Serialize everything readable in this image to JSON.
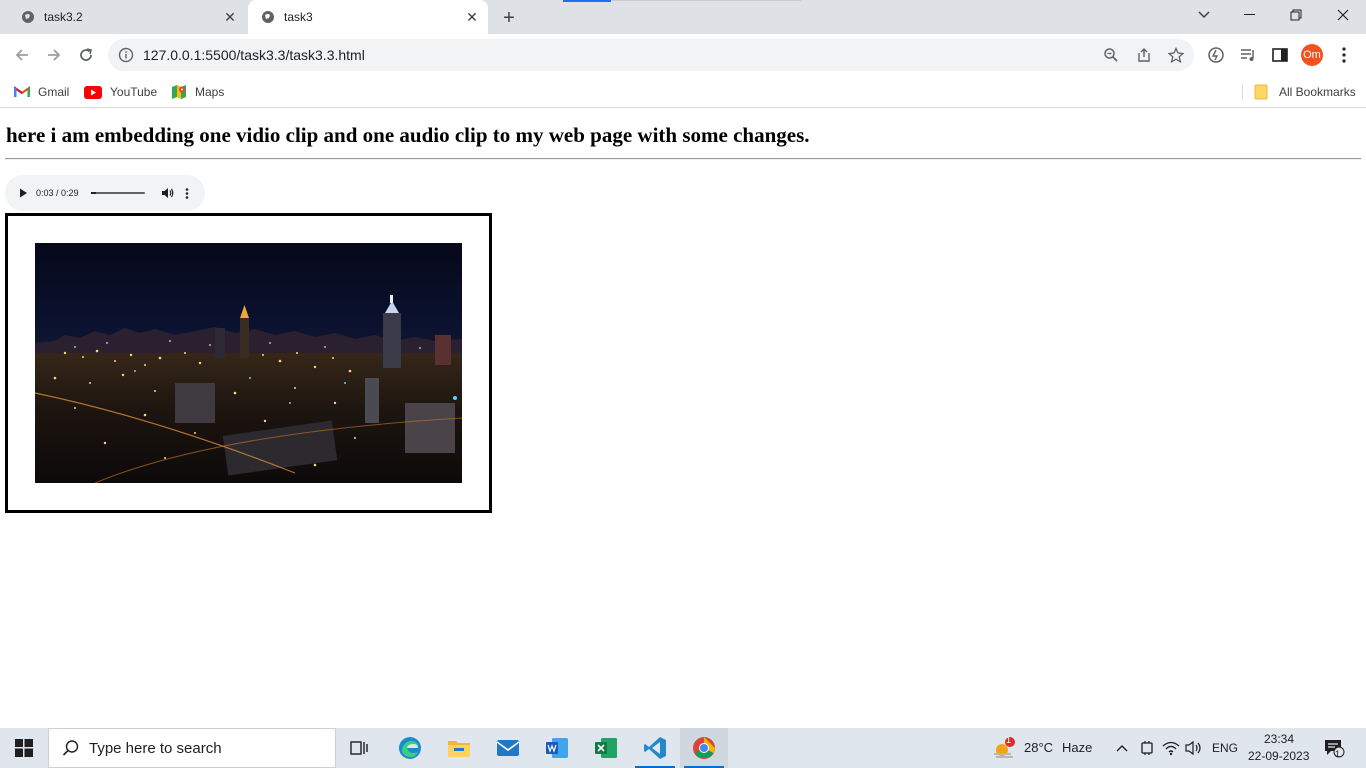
{
  "browser": {
    "tabs": [
      {
        "title": "task3.2",
        "active": false
      },
      {
        "title": "task3",
        "active": true
      }
    ],
    "url": "127.0.0.1:5500/task3.3/task3.3.html",
    "profile_initials": "Om",
    "bookmarks": [
      {
        "label": "Gmail",
        "icon": "gmail-icon"
      },
      {
        "label": "YouTube",
        "icon": "youtube-icon"
      },
      {
        "label": "Maps",
        "icon": "maps-icon"
      }
    ],
    "all_bookmarks_label": "All Bookmarks"
  },
  "page": {
    "heading": "here i am embedding one vidio clip and one audio clip to my web page with some changes.",
    "audio": {
      "time_display": "0:03 / 0:29",
      "progress": 0.1
    },
    "video": {
      "content": "night city skyline"
    }
  },
  "taskbar": {
    "search_placeholder": "Type here to search",
    "weather": {
      "temp": "28°C",
      "condition": "Haze",
      "badge": "1"
    },
    "language": "ENG",
    "time": "23:34",
    "date": "22-09-2023",
    "notification_count": "1"
  },
  "colors": {
    "accent": "#1a73e8",
    "avatar": "#f4511e",
    "taskbar": "#dfe6ee"
  }
}
